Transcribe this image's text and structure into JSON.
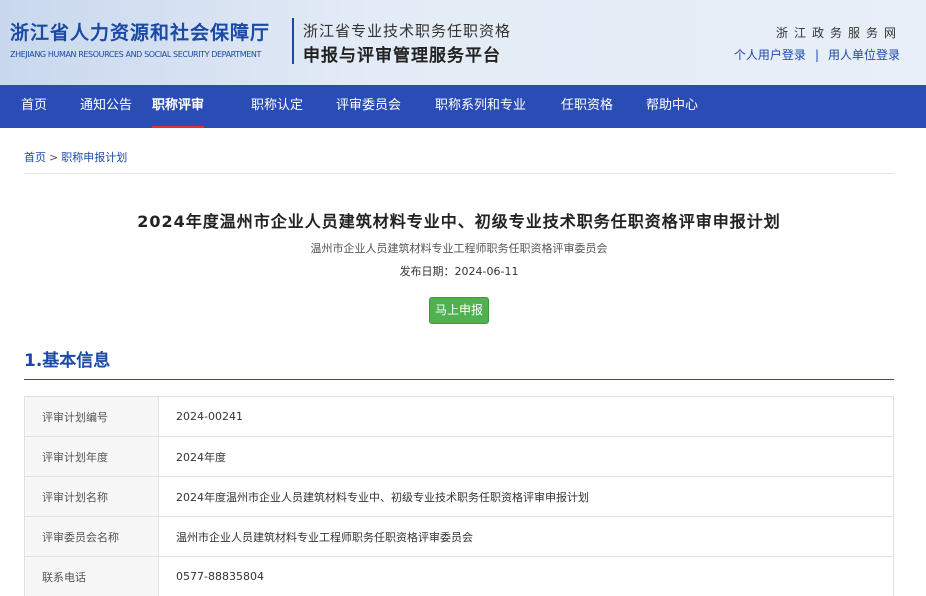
{
  "header": {
    "org_name_cn": "浙江省人力资源和社会保障厅",
    "org_name_en": "ZHEJIANG HUMAN RESOURCES AND SOCIAL SECURITY DEPARTMENT",
    "platform_line1": "浙江省专业技术职务任职资格",
    "platform_line2": "申报与评审管理服务平台",
    "site_domain": "浙江政务服务网",
    "personal_login": "个人用户登录",
    "login_separator": "|",
    "employer_login": "用人单位登录"
  },
  "nav": {
    "items": [
      {
        "label": "首页"
      },
      {
        "label": "通知公告"
      },
      {
        "label": "职称评审"
      },
      {
        "label": "职称认定"
      },
      {
        "label": "评审委员会"
      },
      {
        "label": "职称系列和专业"
      },
      {
        "label": "任职资格"
      },
      {
        "label": "帮助中心"
      }
    ],
    "active": "职称评审"
  },
  "breadcrumb": {
    "home": "首页",
    "separator": ">",
    "current": "职称申报计划"
  },
  "plan": {
    "title": "2024年度温州市企业人员建筑材料专业中、初级专业技术职务任职资格评审申报计划",
    "committee": "温州市企业人员建筑材料专业工程师职务任职资格评审委员会",
    "publish_date": "发布日期：2024-06-11",
    "apply_label": "马上申报"
  },
  "basic_info": {
    "heading": "1.基本信息",
    "rows": [
      {
        "label": "评审计划编号",
        "value": "2024-00241"
      },
      {
        "label": "评审计划年度",
        "value": "2024年度"
      },
      {
        "label": "评审计划名称",
        "value": "2024年度温州市企业人员建筑材料专业中、初级专业技术职务任职资格评审申报计划"
      },
      {
        "label": "评审委员会名称",
        "value": "温州市企业人员建筑材料专业工程师职务任职资格评审委员会"
      },
      {
        "label": "联系电话",
        "value": "0577-88835804"
      }
    ]
  },
  "colors": {
    "brand_blue": "#2a4db5",
    "text_blue": "#1a4aa5",
    "active_underline": "#e0312d",
    "apply_green": "#4fb14f"
  }
}
